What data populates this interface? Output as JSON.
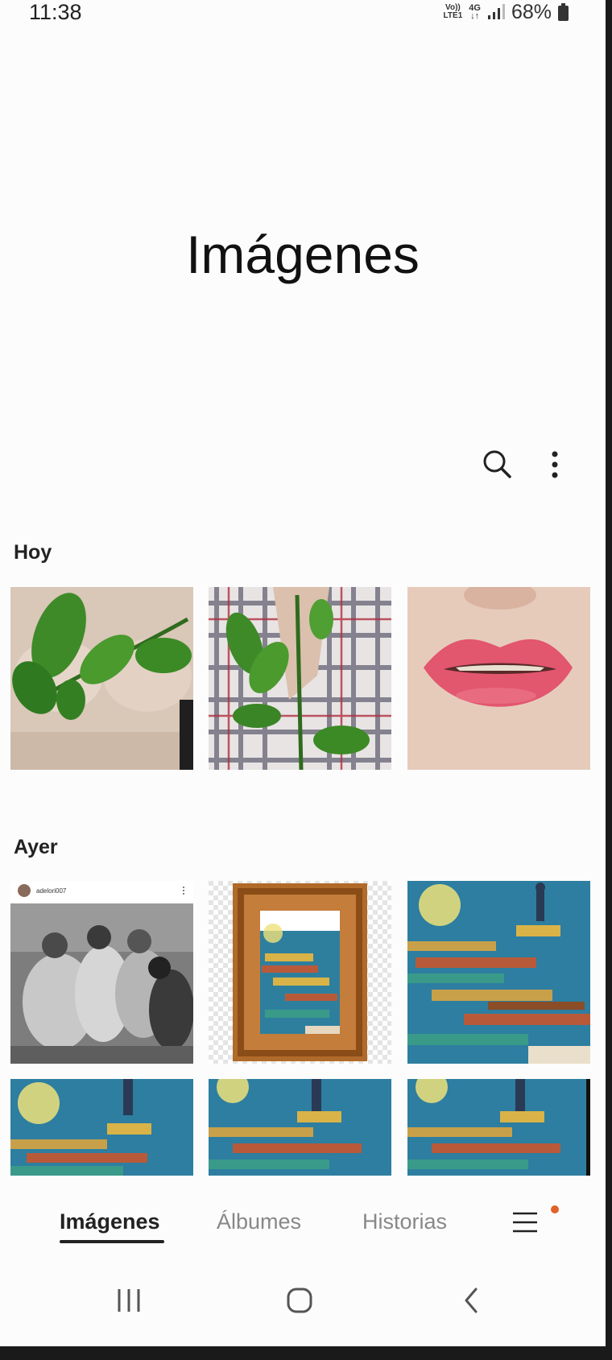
{
  "status_bar": {
    "time": "11:38",
    "volte_top": "Vo))",
    "volte_bottom": "LTE1",
    "network": "4G",
    "battery": "68%"
  },
  "header": {
    "title": "Imágenes",
    "search_icon": "search-icon",
    "more_icon": "more-options-icon"
  },
  "sections": [
    {
      "title": "Hoy"
    },
    {
      "title": "Ayer"
    }
  ],
  "thumbnails": {
    "post_username": "adelori007"
  },
  "tabs": [
    {
      "label": "Imágenes",
      "active": true
    },
    {
      "label": "Álbumes",
      "active": false
    },
    {
      "label": "Historias",
      "active": false
    }
  ],
  "menu": {
    "icon": "hamburger-menu-icon"
  },
  "colors": {
    "accent_dot": "#e0622a",
    "text_primary": "#111111",
    "text_secondary": "#888888"
  },
  "nav_bar": {
    "recents_icon": "recents-icon",
    "home_icon": "home-icon",
    "back_icon": "back-icon"
  }
}
